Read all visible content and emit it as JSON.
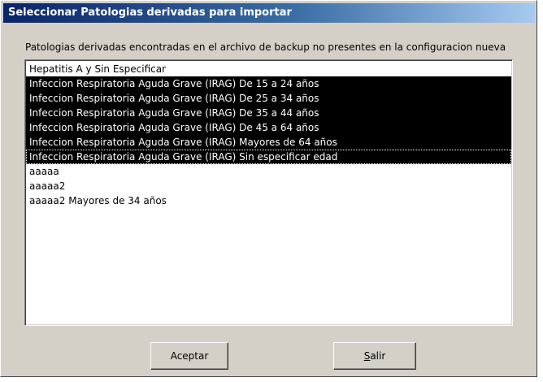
{
  "window": {
    "title": "Seleccionar Patologias derivadas para importar"
  },
  "description": "Patologias derivadas encontradas en el archivo de backup no presentes en la configuracion nueva",
  "list": {
    "items": [
      {
        "label": "Hepatitis A y Sin Especificar",
        "selected": false,
        "focused": false
      },
      {
        "label": "Infeccion Respiratoria Aguda Grave (IRAG) De 15 a 24 años",
        "selected": true,
        "focused": false
      },
      {
        "label": "Infeccion Respiratoria Aguda Grave (IRAG) De 25 a 34 años",
        "selected": true,
        "focused": false
      },
      {
        "label": "Infeccion Respiratoria Aguda Grave (IRAG) De 35 a 44 años",
        "selected": true,
        "focused": false
      },
      {
        "label": "Infeccion Respiratoria Aguda Grave (IRAG) De 45 a 64 años",
        "selected": true,
        "focused": false
      },
      {
        "label": "Infeccion Respiratoria Aguda Grave (IRAG) Mayores de 64 años",
        "selected": true,
        "focused": false
      },
      {
        "label": "Infeccion Respiratoria Aguda Grave (IRAG) Sin especificar edad",
        "selected": true,
        "focused": true
      },
      {
        "label": "aaaaa",
        "selected": false,
        "focused": false
      },
      {
        "label": "aaaaa2",
        "selected": false,
        "focused": false
      },
      {
        "label": "aaaaa2 Mayores de 34 años",
        "selected": false,
        "focused": false
      }
    ]
  },
  "buttons": {
    "accept_label": "Aceptar",
    "exit_accel": "S",
    "exit_rest": "alir"
  }
}
